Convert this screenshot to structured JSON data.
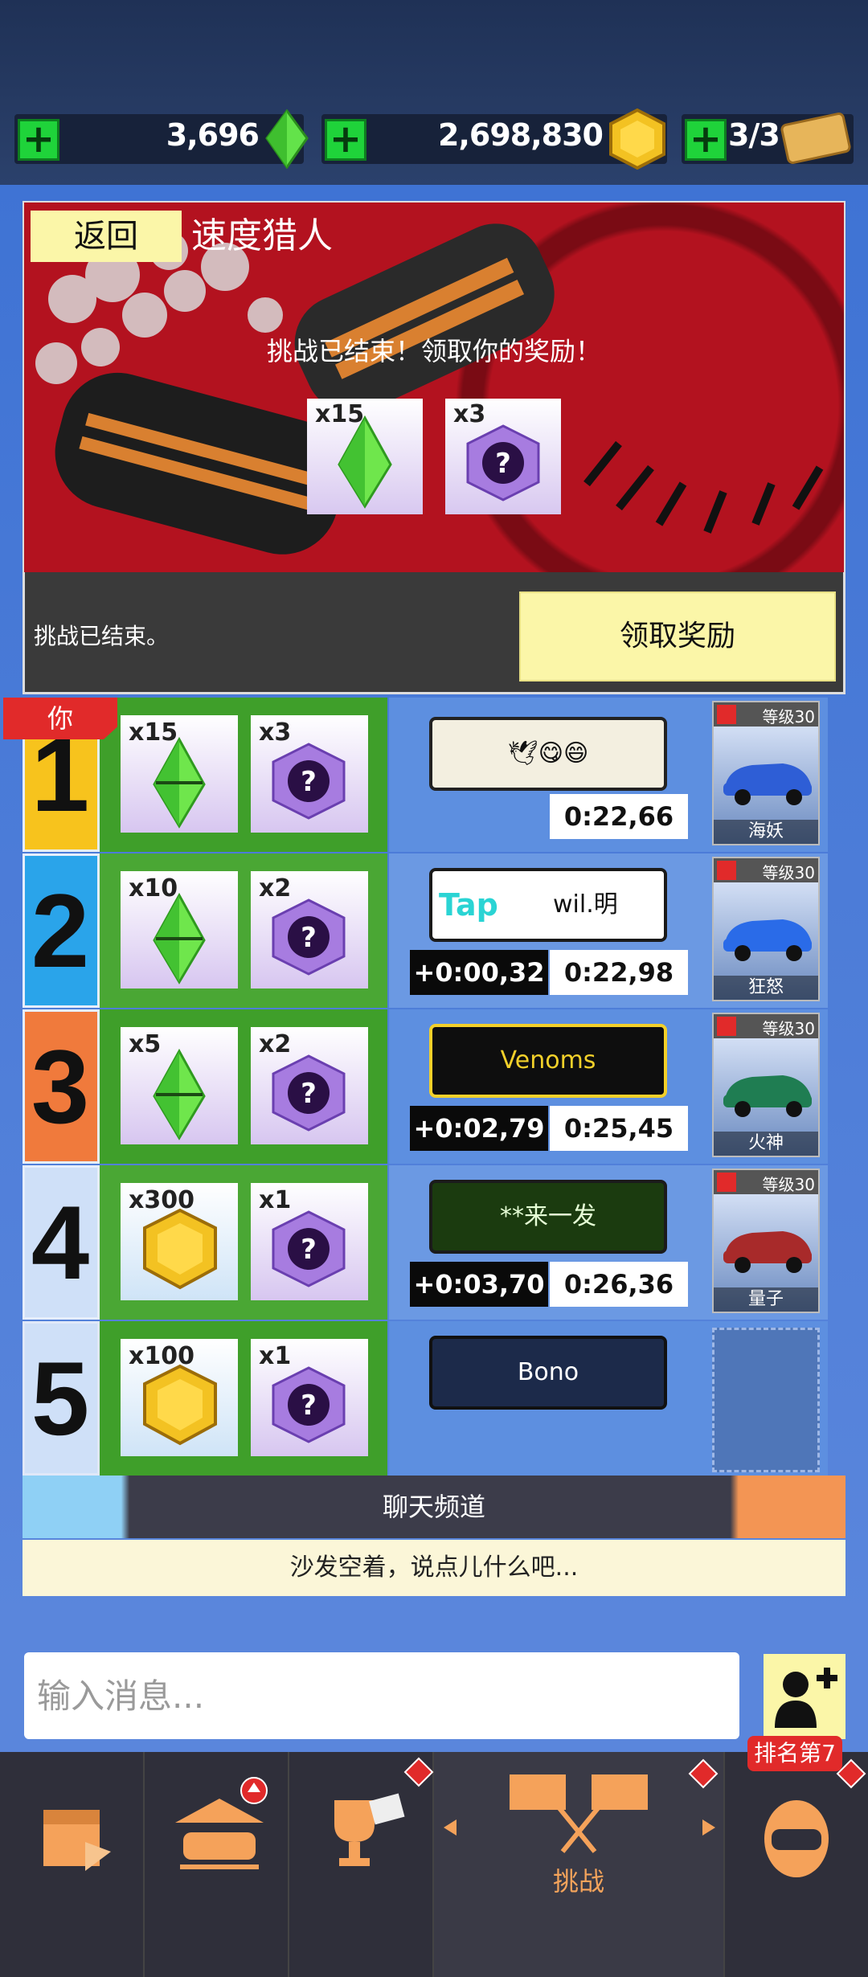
{
  "currency": {
    "gems": "3,696",
    "coins": "2,698,830",
    "tickets": "3/3",
    "plus": "+"
  },
  "panel": {
    "back_label": "返回",
    "title": "速度猎人",
    "ended_message": "挑战已结束！领取你的奖励！",
    "reward_gems": "x15",
    "reward_boxes": "x3",
    "status_text": "挑战已结束。",
    "claim_label": "领取奖励"
  },
  "you_label": "你",
  "rows": [
    {
      "rank": "1",
      "reward_a": "x15",
      "reward_b": "x3",
      "plate": "🕊😋😄",
      "delta": "",
      "time": "0:22,66",
      "car_level": "等级30",
      "car_name": "海妖"
    },
    {
      "rank": "2",
      "reward_a": "x10",
      "reward_b": "x2",
      "plate": "wil.明",
      "plate_tag": "Tap",
      "delta": "+0:00,32",
      "time": "0:22,98",
      "car_level": "等级30",
      "car_name": "狂怒"
    },
    {
      "rank": "3",
      "reward_a": "x5",
      "reward_b": "x2",
      "plate": "Venoms",
      "delta": "+0:02,79",
      "time": "0:25,45",
      "car_level": "等级30",
      "car_name": "火神"
    },
    {
      "rank": "4",
      "reward_a": "x300",
      "reward_b": "x1",
      "plate": "**来一发",
      "delta": "+0:03,70",
      "time": "0:26,36",
      "car_level": "等级30",
      "car_name": "量子"
    },
    {
      "rank": "5",
      "reward_a": "x100",
      "reward_b": "x1",
      "plate": "Bono",
      "delta": "",
      "time": "",
      "car_level": "",
      "car_name": ""
    }
  ],
  "chat": {
    "label": "聊天频道",
    "empty_text": "沙发空着，说点儿什么吧...",
    "input_placeholder": "输入消息..."
  },
  "nav": {
    "active_label": "挑战",
    "rank_badge": "排名第7"
  }
}
